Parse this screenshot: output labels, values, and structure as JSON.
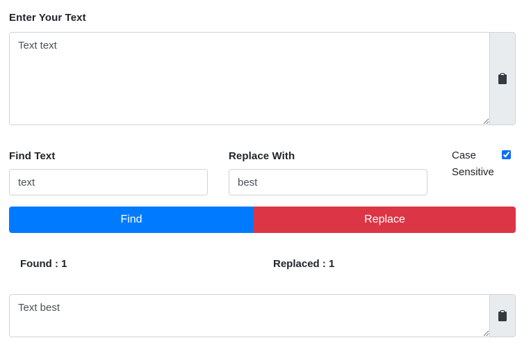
{
  "input_section": {
    "label": "Enter Your Text",
    "value": "Text text"
  },
  "find": {
    "label": "Find Text",
    "value": "text"
  },
  "replace": {
    "label": "Replace With",
    "value": "best"
  },
  "case_sensitive": {
    "label_line1": "Case",
    "label_line2": "Sensitive",
    "checked": true
  },
  "buttons": {
    "find_label": "Find",
    "replace_label": "Replace"
  },
  "stats": {
    "found": "Found : 1",
    "replaced": "Replaced : 1"
  },
  "output_section": {
    "value": "Text best"
  },
  "icons": {
    "clipboard": "clipboard-icon"
  },
  "colors": {
    "find_button": "#007bff",
    "replace_button": "#dc3545",
    "addon_bg": "#e9ecef",
    "border": "#ced4da"
  }
}
